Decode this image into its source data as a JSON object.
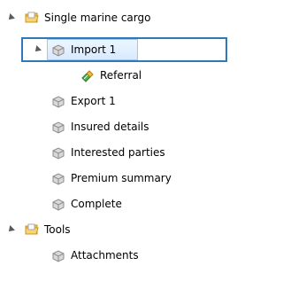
{
  "tree": {
    "items": [
      {
        "label": "Single marine cargo",
        "icon": "folder-icon",
        "expanded": true
      },
      {
        "label": "Import 1",
        "icon": "cargo-icon",
        "expanded": true,
        "selected": true
      },
      {
        "label": "Referral",
        "icon": "referral-icon"
      },
      {
        "label": "Export 1",
        "icon": "cargo-icon"
      },
      {
        "label": "Insured details",
        "icon": "cargo-icon"
      },
      {
        "label": "Interested parties",
        "icon": "cargo-icon"
      },
      {
        "label": "Premium summary",
        "icon": "cargo-icon"
      },
      {
        "label": "Complete",
        "icon": "cargo-icon"
      },
      {
        "label": "Tools",
        "icon": "folder-icon",
        "expanded": true
      },
      {
        "label": "Attachments",
        "icon": "cargo-icon"
      }
    ]
  },
  "colors": {
    "selection_border": "#2f79b8",
    "selection_fill_top": "#eef6ff",
    "selection_fill_bottom": "#d7eaff",
    "expander": "#5a5a5a",
    "folder": "#f0b93d",
    "cargo": "#c8c8c8",
    "referral": "#3f9b3c"
  }
}
